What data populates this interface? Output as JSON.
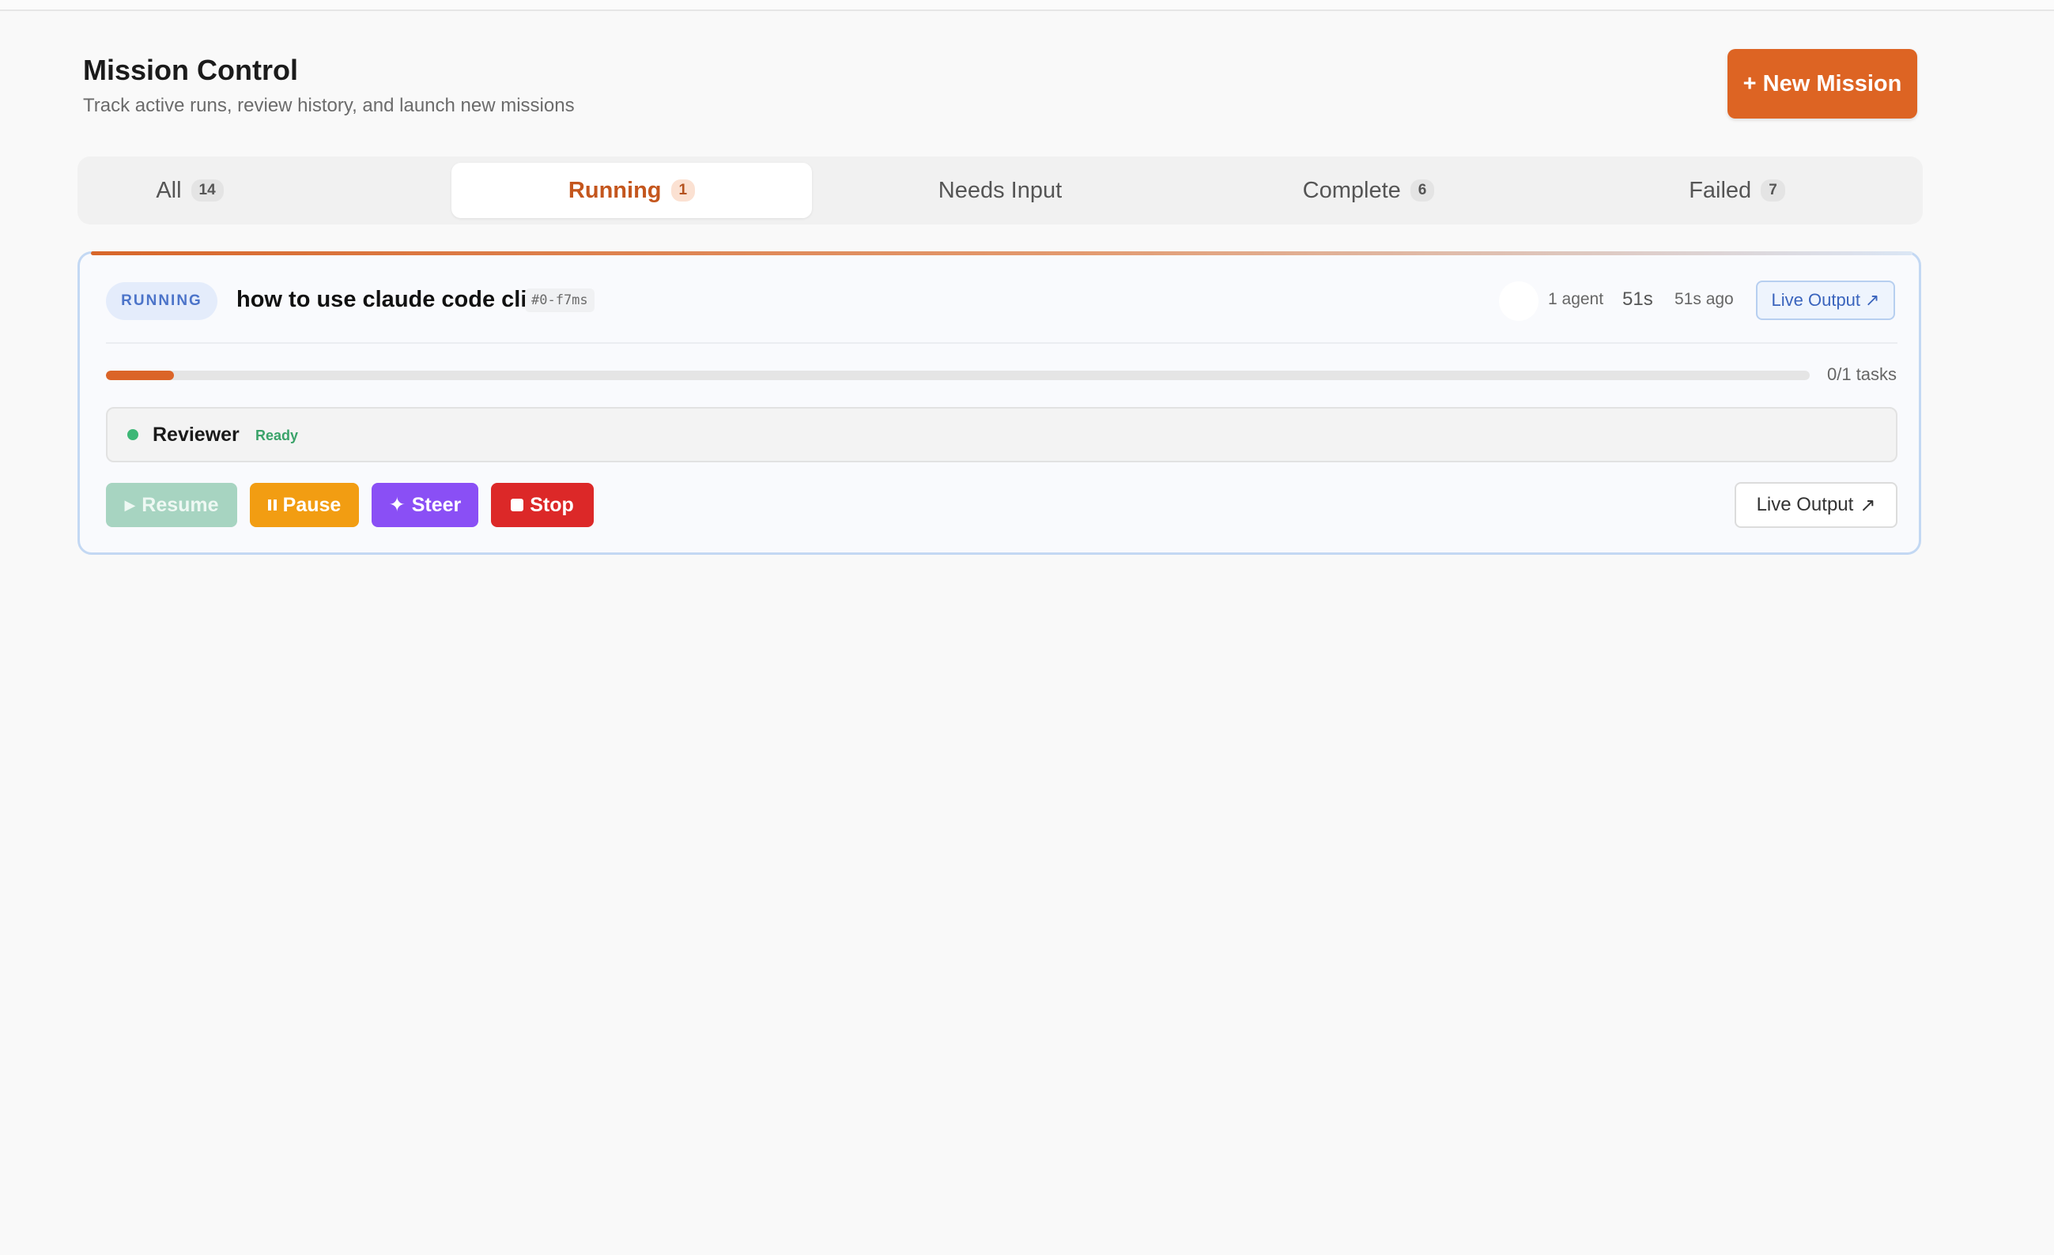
{
  "header": {
    "title": "Mission Control",
    "subtitle": "Track active runs, review history, and launch new missions",
    "new_mission_label": "+ New Mission"
  },
  "tabs": [
    {
      "label": "All",
      "count": "14"
    },
    {
      "label": "Running",
      "count": "1"
    },
    {
      "label": "Needs Input",
      "count": ""
    },
    {
      "label": "Complete",
      "count": "6"
    },
    {
      "label": "Failed",
      "count": "7"
    }
  ],
  "active_tab": "Running",
  "mission": {
    "status": "RUNNING",
    "title": "how to use claude code cli",
    "id": "#0-f7ms",
    "agent_count": "1 agent",
    "elapsed": "51s",
    "updated": "51s ago",
    "live_output_label": "Live Output",
    "progress_fraction": 0.04,
    "progress_label": "0/1 tasks",
    "agent": {
      "name": "Reviewer",
      "state": "Ready"
    },
    "controls": {
      "resume": "Resume",
      "pause": "Pause",
      "steer": "Steer",
      "stop": "Stop",
      "live_output": "Live Output"
    }
  },
  "icons": {
    "arrow": "↗",
    "play": "▶",
    "sparkle": "✦"
  },
  "colors": {
    "accent": "#dd6423",
    "running_badge": "#4c74c9",
    "ready": "#3aa36a",
    "pause": "#f29d12",
    "steer": "#8a4ff5",
    "stop": "#dc2828",
    "resume_disabled": "#a7d4c1"
  }
}
